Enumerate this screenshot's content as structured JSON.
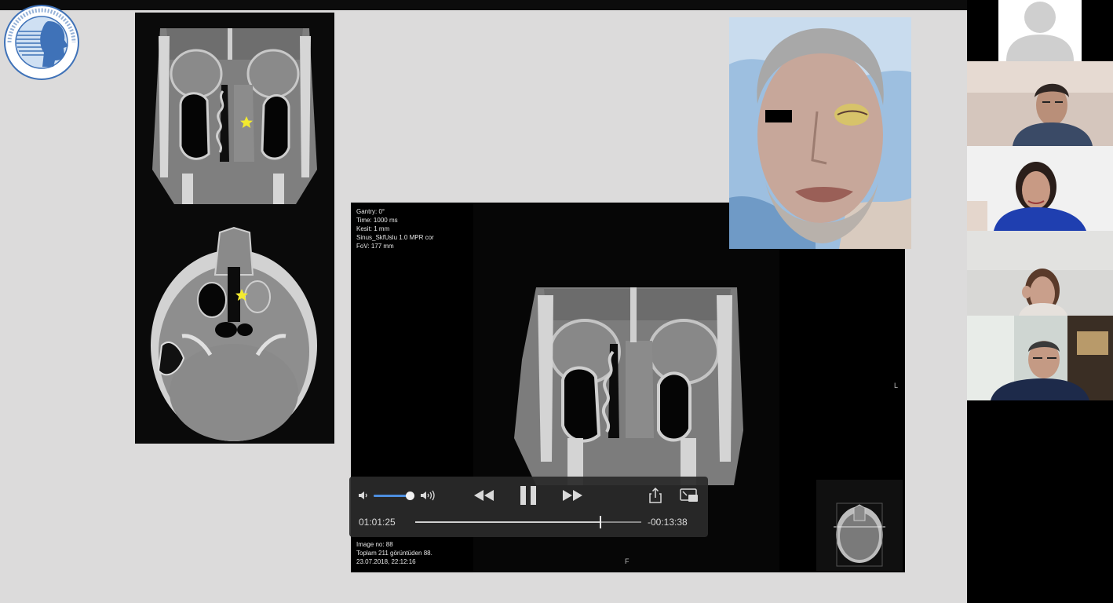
{
  "slide": {
    "viewer": {
      "meta_top": [
        "Gantry: 0°",
        "Time: 1000 ms",
        "Kesit: 1 mm",
        "Sinus_SkfUslu 1.0 MPR cor",
        "FoV: 177 mm"
      ],
      "meta_bottom": [
        "Image no: 88",
        "Toplam 211 görüntüden 88.",
        "23.07.2018, 22:12:16"
      ],
      "orientation_bottom": "F",
      "orientation_right": "L"
    }
  },
  "player": {
    "elapsed": "01:01:25",
    "remaining": "-00:13:38",
    "progress": 0.82,
    "volume": 0.95,
    "icons": {
      "volume_low": "speaker-low-icon",
      "volume_high": "speaker-high-icon",
      "rewind": "rewind-icon",
      "pause": "pause-icon",
      "forward": "fast-forward-icon",
      "share": "share-icon",
      "pip": "picture-in-picture-icon"
    },
    "accent": "#4d8fe0"
  },
  "participants": [
    {
      "kind": "avatar-placeholder"
    },
    {
      "kind": "video"
    },
    {
      "kind": "video"
    },
    {
      "kind": "video"
    },
    {
      "kind": "video"
    }
  ],
  "colors": {
    "slide_background": "#dcdbdb",
    "marker": "#f3ea2f"
  }
}
